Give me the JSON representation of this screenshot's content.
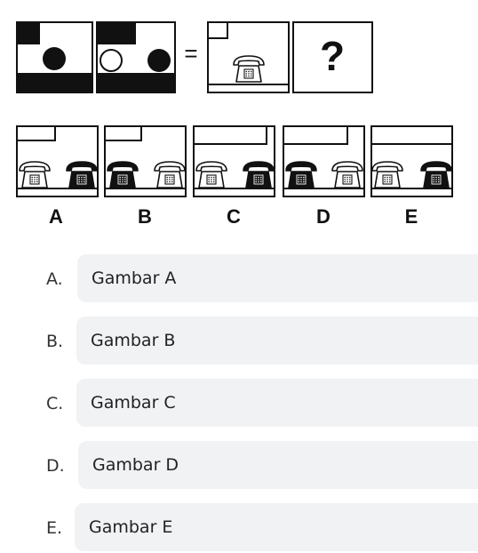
{
  "question": {
    "equals_sign": "=",
    "question_mark": "?"
  },
  "options_strip": {
    "letters": [
      "A",
      "B",
      "C",
      "D",
      "E"
    ]
  },
  "answers": [
    {
      "letter": "A.",
      "text": "Gambar A"
    },
    {
      "letter": "B.",
      "text": "Gambar B"
    },
    {
      "letter": "C.",
      "text": "Gambar C"
    },
    {
      "letter": "D.",
      "text": "Gambar D"
    },
    {
      "letter": "E.",
      "text": "Gambar E"
    }
  ],
  "icons": [
    "telephone-outline-icon",
    "telephone-solid-icon",
    "filled-circle-icon",
    "hollow-circle-icon"
  ]
}
